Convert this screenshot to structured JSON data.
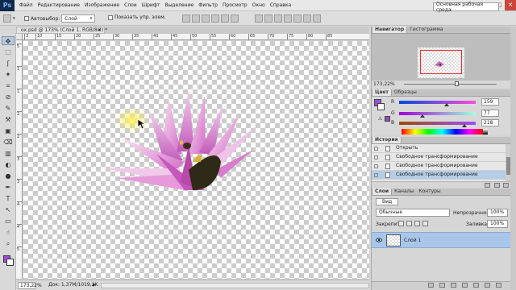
{
  "app": {
    "logo": "Ps"
  },
  "menu": [
    "Файл",
    "Редактирование",
    "Изображение",
    "Слои",
    "Шрифт",
    "Выделение",
    "Фильтр",
    "Просмотр",
    "Окно",
    "Справка"
  ],
  "window_controls": {
    "minimize": "–",
    "maximize": "□",
    "close": "✕"
  },
  "options": {
    "autoselect_label": "Автовыбор:",
    "autoselect_value": "Слой",
    "show_transform_label": "Показать упр. элем.",
    "workspace": "Основная рабочая среда"
  },
  "document": {
    "tab_title": "ox.psd @ 173% (Слой 1, RGB/8#) *",
    "tab_close": "×",
    "ruler_marks": [
      "3",
      "10",
      "15",
      "20",
      "25",
      "30",
      "35",
      "40",
      "45",
      "50",
      "55",
      "60",
      "65",
      "70",
      "75",
      "80",
      "85"
    ],
    "ruler_v_marks": [
      "5",
      "1",
      "1",
      "2",
      "2",
      "3",
      "3",
      "4",
      "4",
      "5"
    ]
  },
  "status": {
    "zoom": "173,22%",
    "info": "Док: 1,37M/1019,2K",
    "arrow": "▶"
  },
  "navigator": {
    "tabs": [
      "Навигатор",
      "Гистограмма"
    ],
    "zoom": "173,22%"
  },
  "color": {
    "tabs": [
      "Цвет",
      "Образцы"
    ],
    "r_label": "R",
    "g_label": "G",
    "b_label": "B",
    "r": "159",
    "g": "77",
    "b": "218",
    "warn": "⚠",
    "fg_color": "#9f4dda",
    "r_frac": 0.62,
    "g_frac": 0.3,
    "b_frac": 0.85
  },
  "history": {
    "tabs": [
      "История"
    ],
    "items": [
      "Открыть",
      "Свободное трансформирование",
      "Свободное трансформирование",
      "Свободное трансформирование"
    ],
    "selected_index": 3
  },
  "layers": {
    "tabs": [
      "Слои",
      "Каналы",
      "Контуры"
    ],
    "filter": "Вид",
    "blend_mode": "Обычные",
    "opacity_label": "Непрозрачность:",
    "opacity": "100%",
    "lock_label": "Закрепить:",
    "fill_label": "Заливка:",
    "fill": "100%",
    "layer_name": "Слой 1",
    "eye": "👁"
  },
  "tools": [
    "✥",
    "⬚",
    "ʃ",
    "✦",
    "⌗",
    "⊘",
    "✎",
    "⚒",
    "▣",
    "⌫",
    "▥",
    "◐",
    "●",
    "✒",
    "T",
    "↖",
    "▭",
    "☝",
    "⌕"
  ]
}
